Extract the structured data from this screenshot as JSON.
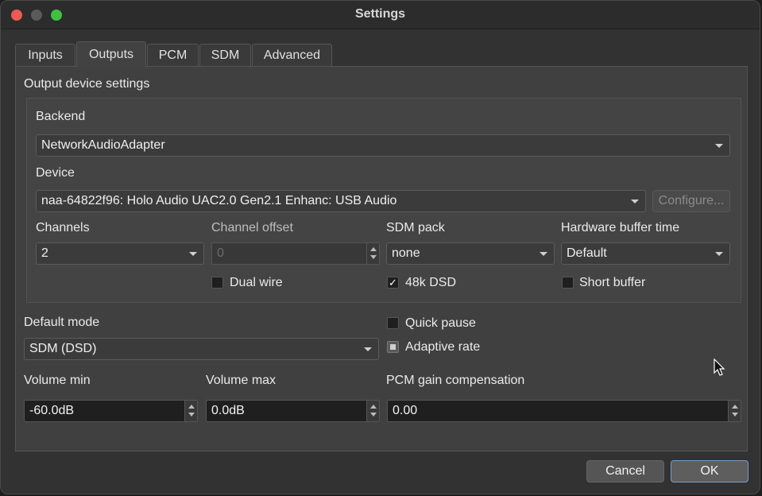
{
  "window": {
    "title": "Settings"
  },
  "tabs": [
    {
      "label": "Inputs"
    },
    {
      "label": "Outputs"
    },
    {
      "label": "PCM"
    },
    {
      "label": "SDM"
    },
    {
      "label": "Advanced"
    }
  ],
  "output_device": {
    "group_title": "Output device settings",
    "backend_label": "Backend",
    "backend_value": "NetworkAudioAdapter",
    "device_label": "Device",
    "device_value": "naa-64822f96: Holo Audio UAC2.0 Gen2.1 Enhanc: USB Audio",
    "configure_label": "Configure...",
    "channels_label": "Channels",
    "channels_value": "2",
    "channel_offset_label": "Channel offset",
    "channel_offset_value": "0",
    "sdm_pack_label": "SDM pack",
    "sdm_pack_value": "none",
    "hw_buffer_label": "Hardware buffer time",
    "hw_buffer_value": "Default",
    "dual_wire_label": "Dual wire",
    "dsd48k_label": "48k DSD",
    "dsd48k_mark": "✓",
    "short_buffer_label": "Short buffer"
  },
  "mode": {
    "default_mode_label": "Default mode",
    "default_mode_value": "SDM (DSD)",
    "quick_pause_label": "Quick pause",
    "adaptive_rate_label": "Adaptive rate"
  },
  "volume": {
    "min_label": "Volume min",
    "min_value": "-60.0dB",
    "max_label": "Volume max",
    "max_value": "0.0dB",
    "pcm_gain_label": "PCM gain compensation",
    "pcm_gain_value": "0.00"
  },
  "footer": {
    "cancel_label": "Cancel",
    "ok_label": "OK"
  }
}
